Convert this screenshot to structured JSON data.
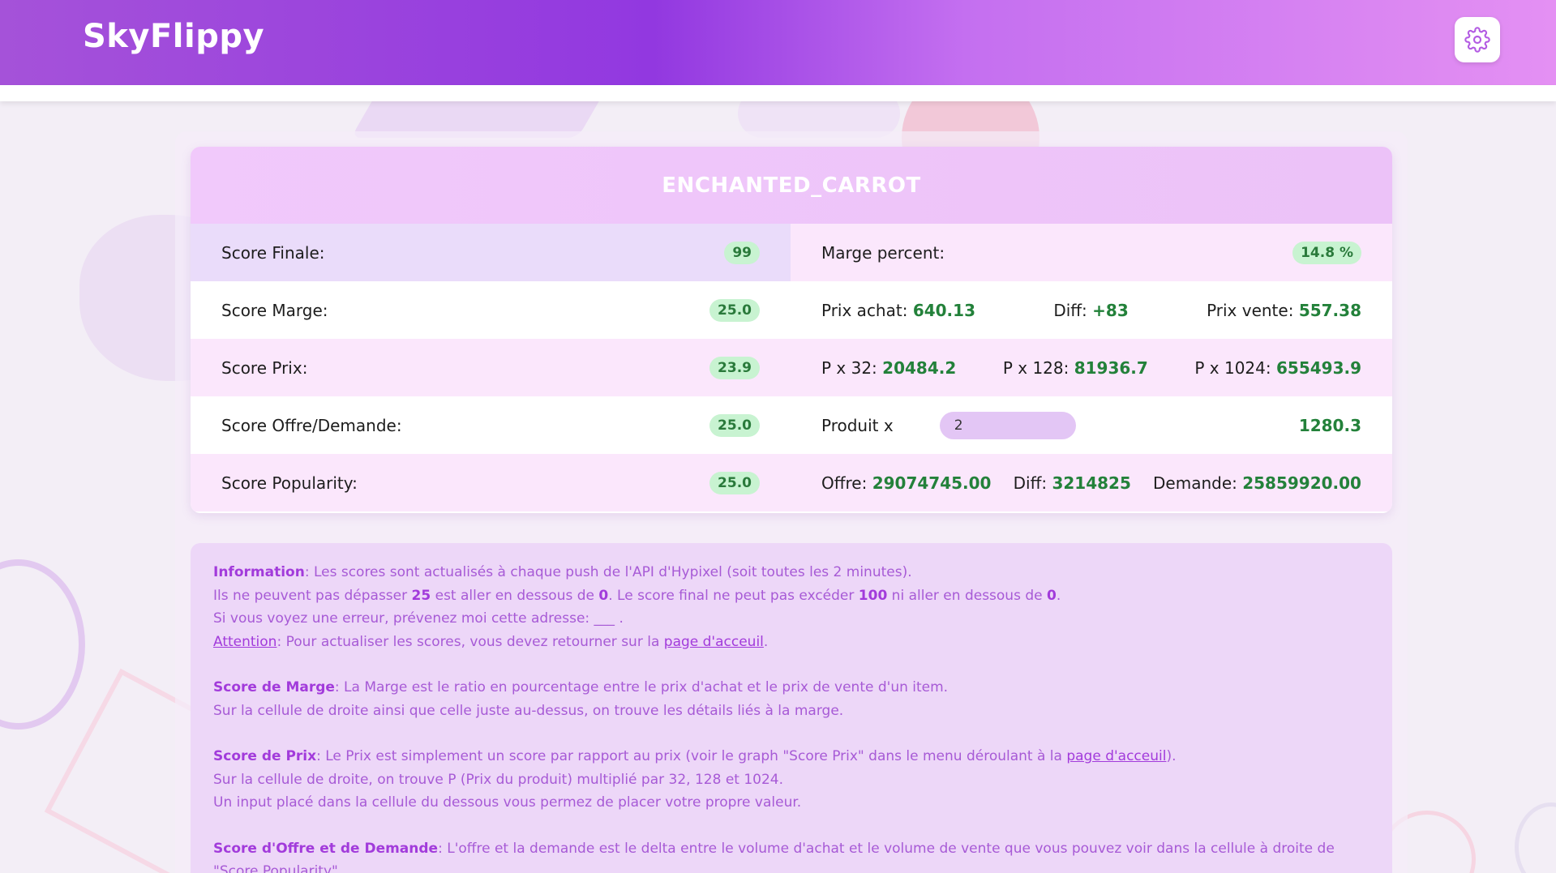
{
  "app": {
    "title": "SkyFlippy"
  },
  "header": {
    "settings_icon": "gear-icon"
  },
  "item": {
    "name": "ENCHANTED_CARROT",
    "rows": [
      {
        "left_label": "Score Finale:",
        "left_value": "99",
        "right": {
          "label": "Marge percent:",
          "value": "14.8 %"
        }
      },
      {
        "left_label": "Score Marge:",
        "left_value": "25.0",
        "right": {
          "prix_achat_label": "Prix achat:",
          "prix_achat": "640.13",
          "diff_label": "Diff:",
          "diff": "+83",
          "prix_vente_label": "Prix vente:",
          "prix_vente": "557.38"
        }
      },
      {
        "left_label": "Score Prix:",
        "left_value": "23.9",
        "right": {
          "p32_label": "P x 32:",
          "p32": "20484.2",
          "p128_label": "P x 128:",
          "p128": "81936.7",
          "p1024_label": "P x 1024:",
          "p1024": "655493.9"
        }
      },
      {
        "left_label": "Score Offre/Demande:",
        "left_value": "25.0",
        "right": {
          "produit_label": "Produit x",
          "produit_input": "2",
          "produit_result": "1280.3"
        }
      },
      {
        "left_label": "Score Popularity:",
        "left_value": "25.0",
        "right": {
          "offre_label": "Offre:",
          "offre": "29074745.00",
          "diff_label": "Diff:",
          "diff": "3214825",
          "demande_label": "Demande:",
          "demande": "25859920.00"
        }
      }
    ]
  },
  "info": {
    "p1": {
      "info_label": "Information",
      "info_text": ": Les scores sont actualisés à chaque push de l'API d'Hypixel (soit toutes les 2 minutes).",
      "line2_a": "Ils ne peuvent pas dépasser ",
      "line2_b": "25",
      "line2_c": " est aller en dessous de ",
      "line2_d": "0",
      "line2_e": ". Le score final ne peut pas excéder ",
      "line2_f": "100",
      "line2_g": " ni aller en dessous de ",
      "line2_h": "0",
      "line2_i": ".",
      "line3": "Si vous voyez une erreur, prévenez moi cette adresse: ___ .",
      "attention_label": "Attention",
      "attention_text": ": Pour actualiser les scores, vous devez retourner sur la ",
      "attention_link": "page d'acceuil",
      "attention_end": "."
    },
    "p2": {
      "label": "Score de Marge",
      "text": ": La Marge est le ratio en pourcentage entre le prix d'achat et le prix de vente d'un item.",
      "line2": "Sur la cellule de droite ainsi que celle juste au-dessus, on trouve les détails liés à la marge."
    },
    "p3": {
      "label": "Score de Prix",
      "text": ": Le Prix est simplement un score par rapport au prix (voir le graph \"Score Prix\" dans le menu déroulant à la ",
      "link": "page d'acceuil",
      "end": ").",
      "line2": "Sur la cellule de droite, on trouve P (Prix du produit) multiplié par 32, 128 et 1024.",
      "line3": "Un input placé dans la cellule du dessous vous permez de placer votre propre valeur."
    },
    "p4": {
      "label": "Score d'Offre et de Demande",
      "text": ": L'offre et la demande est le delta entre le volume d'achat et le volume de vente que vous pouvez voir dans la cellule à droite de \"Score Popularity\"."
    }
  },
  "colors": {
    "header_gradient_start": "#a552d9",
    "header_gradient_mid": "#9238e0",
    "header_gradient_end": "#e490f3",
    "badge_bg": "#c8f3d1",
    "value_green": "#23813a",
    "info_text": "#a75ad6"
  }
}
